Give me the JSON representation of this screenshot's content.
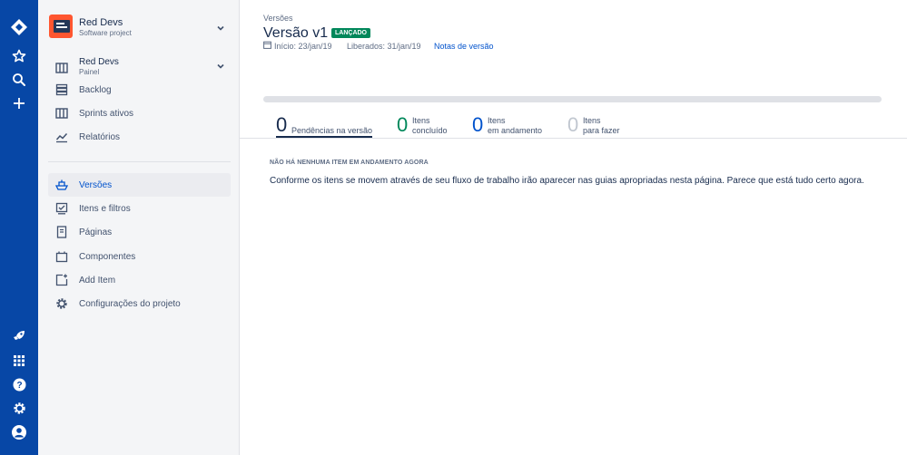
{
  "global_nav": {
    "top_icons": [
      "jira-logo-icon",
      "star-icon",
      "search-icon",
      "plus-icon"
    ],
    "bottom_icons": [
      "rocket-icon",
      "app-switcher-icon",
      "help-icon",
      "settings-icon",
      "profile-icon"
    ]
  },
  "project": {
    "name": "Red Devs",
    "type": "Software project"
  },
  "board": {
    "name": "Red Devs",
    "subtitle": "Painel"
  },
  "sidebar": {
    "items": [
      {
        "label": "Backlog",
        "icon": "backlog-icon"
      },
      {
        "label": "Sprints ativos",
        "icon": "board-icon"
      },
      {
        "label": "Relatórios",
        "icon": "reports-icon"
      }
    ],
    "items2": [
      {
        "label": "Versões",
        "icon": "ship-icon",
        "active": true
      },
      {
        "label": "Itens e filtros",
        "icon": "issues-icon"
      },
      {
        "label": "Páginas",
        "icon": "page-icon"
      },
      {
        "label": "Componentes",
        "icon": "component-icon"
      },
      {
        "label": "Add Item",
        "icon": "add-item-icon"
      },
      {
        "label": "Configurações do projeto",
        "icon": "settings-icon"
      }
    ]
  },
  "main": {
    "breadcrumb": "Versões",
    "title": "Versão v1",
    "status": "LANÇADO",
    "start": "Início: 23/jan/19",
    "released": "Liberados: 31/jan/19",
    "release_notes": "Notas de versão",
    "stats": [
      {
        "num": "0",
        "l1": "Pendências na versão",
        "l2": "",
        "color": "#172b4d"
      },
      {
        "num": "0",
        "l1": "Itens",
        "l2": "concluído",
        "color": "#00875a"
      },
      {
        "num": "0",
        "l1": "Itens",
        "l2": "em andamento",
        "color": "#0052cc"
      },
      {
        "num": "0",
        "l1": "Itens",
        "l2": "para fazer",
        "color": "#c1c7d0"
      }
    ],
    "empty_heading": "NÃO HÁ NENHUMA ITEM EM ANDAMENTO AGORA",
    "empty_body": "Conforme os itens se movem através de seu fluxo de trabalho irão aparecer nas guias apropriadas nesta página. Parece que está tudo certo agora."
  }
}
